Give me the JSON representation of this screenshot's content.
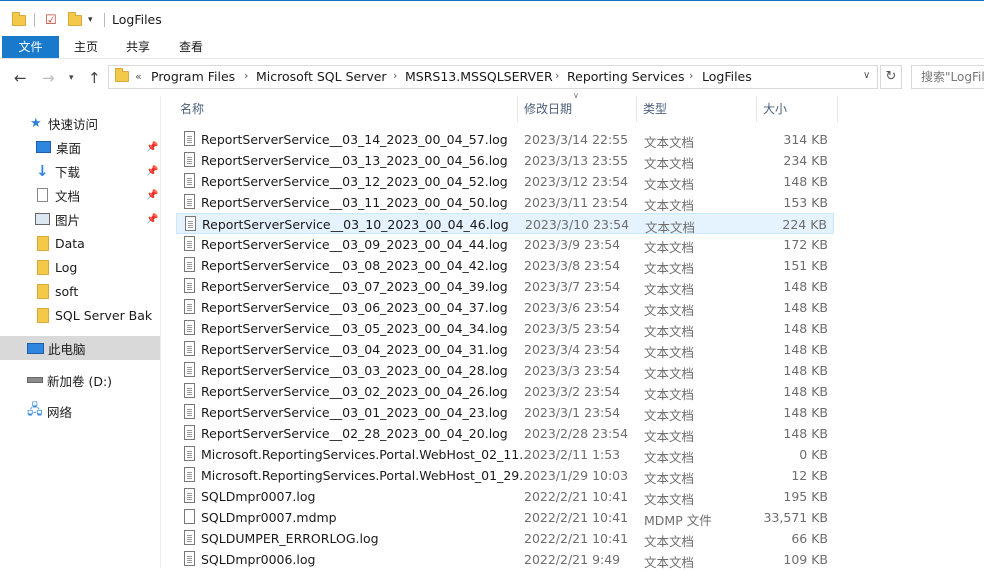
{
  "window": {
    "title": "LogFiles"
  },
  "ribbon": {
    "tabs": [
      "文件",
      "主页",
      "共享",
      "查看"
    ]
  },
  "address": {
    "crumbs": [
      "Program Files",
      "Microsoft SQL Server",
      "MSRS13.MSSQLSERVER",
      "Reporting Services",
      "LogFiles"
    ],
    "overflow": "«",
    "search_placeholder": "搜索\"LogFiles\""
  },
  "nav": {
    "items": [
      {
        "label": "快速访问",
        "icon": "star-icon"
      },
      {
        "label": "桌面",
        "icon": "desktop-icon",
        "pinned": true
      },
      {
        "label": "下载",
        "icon": "download-icon",
        "pinned": true
      },
      {
        "label": "文档",
        "icon": "document-icon",
        "pinned": true
      },
      {
        "label": "图片",
        "icon": "pictures-icon",
        "pinned": true
      },
      {
        "label": "Data",
        "icon": "folder-icon"
      },
      {
        "label": "Log",
        "icon": "folder-icon"
      },
      {
        "label": "soft",
        "icon": "folder-icon"
      },
      {
        "label": "SQL Server Bak",
        "icon": "folder-icon"
      },
      {
        "label": "此电脑",
        "icon": "computer-icon",
        "selected": true
      },
      {
        "label": "新加卷 (D:)",
        "icon": "drive-icon"
      },
      {
        "label": "网络",
        "icon": "network-icon"
      }
    ]
  },
  "columns": {
    "name": "名称",
    "date": "修改日期",
    "type": "类型",
    "size": "大小"
  },
  "files": [
    {
      "name": "ReportServerService__03_14_2023_00_04_57.log",
      "date": "2023/3/14 22:55",
      "type": "文本文档",
      "size": "314 KB"
    },
    {
      "name": "ReportServerService__03_13_2023_00_04_56.log",
      "date": "2023/3/13 23:55",
      "type": "文本文档",
      "size": "234 KB"
    },
    {
      "name": "ReportServerService__03_12_2023_00_04_52.log",
      "date": "2023/3/12 23:54",
      "type": "文本文档",
      "size": "148 KB"
    },
    {
      "name": "ReportServerService__03_11_2023_00_04_50.log",
      "date": "2023/3/11 23:54",
      "type": "文本文档",
      "size": "153 KB"
    },
    {
      "name": "ReportServerService__03_10_2023_00_04_46.log",
      "date": "2023/3/10 23:54",
      "type": "文本文档",
      "size": "224 KB",
      "selected": true
    },
    {
      "name": "ReportServerService__03_09_2023_00_04_44.log",
      "date": "2023/3/9 23:54",
      "type": "文本文档",
      "size": "172 KB"
    },
    {
      "name": "ReportServerService__03_08_2023_00_04_42.log",
      "date": "2023/3/8 23:54",
      "type": "文本文档",
      "size": "151 KB"
    },
    {
      "name": "ReportServerService__03_07_2023_00_04_39.log",
      "date": "2023/3/7 23:54",
      "type": "文本文档",
      "size": "148 KB"
    },
    {
      "name": "ReportServerService__03_06_2023_00_04_37.log",
      "date": "2023/3/6 23:54",
      "type": "文本文档",
      "size": "148 KB"
    },
    {
      "name": "ReportServerService__03_05_2023_00_04_34.log",
      "date": "2023/3/5 23:54",
      "type": "文本文档",
      "size": "148 KB"
    },
    {
      "name": "ReportServerService__03_04_2023_00_04_31.log",
      "date": "2023/3/4 23:54",
      "type": "文本文档",
      "size": "148 KB"
    },
    {
      "name": "ReportServerService__03_03_2023_00_04_28.log",
      "date": "2023/3/3 23:54",
      "type": "文本文档",
      "size": "148 KB"
    },
    {
      "name": "ReportServerService__03_02_2023_00_04_26.log",
      "date": "2023/3/2 23:54",
      "type": "文本文档",
      "size": "148 KB"
    },
    {
      "name": "ReportServerService__03_01_2023_00_04_23.log",
      "date": "2023/3/1 23:54",
      "type": "文本文档",
      "size": "148 KB"
    },
    {
      "name": "ReportServerService__02_28_2023_00_04_20.log",
      "date": "2023/2/28 23:54",
      "type": "文本文档",
      "size": "148 KB"
    },
    {
      "name": "Microsoft.ReportingServices.Portal.WebHost_02_11...",
      "date": "2023/2/11 1:53",
      "type": "文本文档",
      "size": "0 KB"
    },
    {
      "name": "Microsoft.ReportingServices.Portal.WebHost_01_29...",
      "date": "2023/1/29 10:03",
      "type": "文本文档",
      "size": "12 KB"
    },
    {
      "name": "SQLDmpr0007.log",
      "date": "2022/2/21 10:41",
      "type": "文本文档",
      "size": "195 KB"
    },
    {
      "name": "SQLDmpr0007.mdmp",
      "date": "2022/2/21 10:41",
      "type": "MDMP 文件",
      "size": "33,571 KB",
      "blank_icon": true
    },
    {
      "name": "SQLDUMPER_ERRORLOG.log",
      "date": "2022/2/21 10:41",
      "type": "文本文档",
      "size": "66 KB"
    },
    {
      "name": "SQLDmpr0006.log",
      "date": "2022/2/21 9:49",
      "type": "文本文档",
      "size": "109 KB"
    }
  ]
}
